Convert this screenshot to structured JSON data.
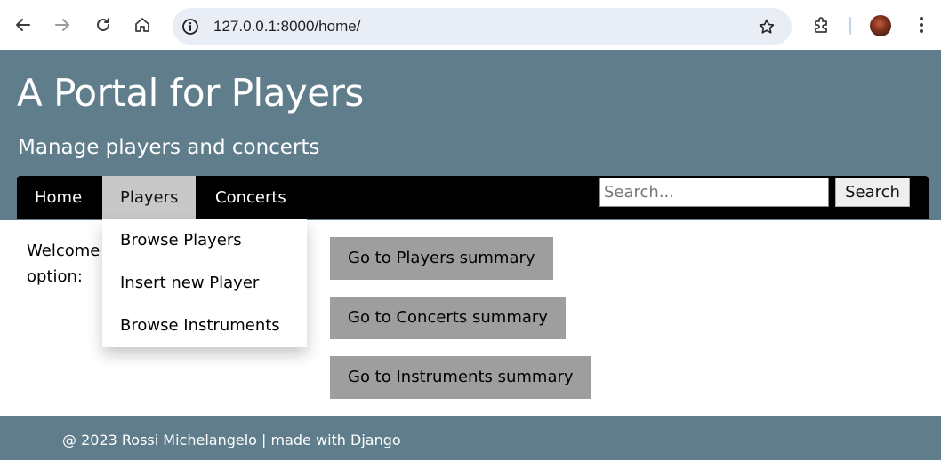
{
  "browser": {
    "url": "127.0.0.1:8000/home/",
    "icons": [
      "back-arrow-icon",
      "forward-arrow-icon",
      "reload-icon",
      "home-icon",
      "info-icon",
      "star-icon",
      "extensions-icon",
      "kebab-menu-icon"
    ]
  },
  "header": {
    "title": "A Portal for Players",
    "subtitle": "Manage players and concerts",
    "background_color": "#607d8b"
  },
  "nav": {
    "items": [
      {
        "label": "Home"
      },
      {
        "label": "Players",
        "active": true
      },
      {
        "label": "Concerts"
      }
    ],
    "search": {
      "placeholder": "Search...",
      "button_label": "Search"
    }
  },
  "dropdown": {
    "items": [
      {
        "label": "Browse Players"
      },
      {
        "label": "Insert new Player"
      },
      {
        "label": "Browse Instruments"
      }
    ]
  },
  "main": {
    "welcome_line1": "Welcome",
    "welcome_line2": "option:",
    "buttons": [
      {
        "label": "Go to Players summary"
      },
      {
        "label": "Go to Concerts summary"
      },
      {
        "label": "Go to Instruments summary"
      }
    ]
  },
  "footer": {
    "text": "@ 2023 Rossi Michelangelo | made with Django"
  }
}
